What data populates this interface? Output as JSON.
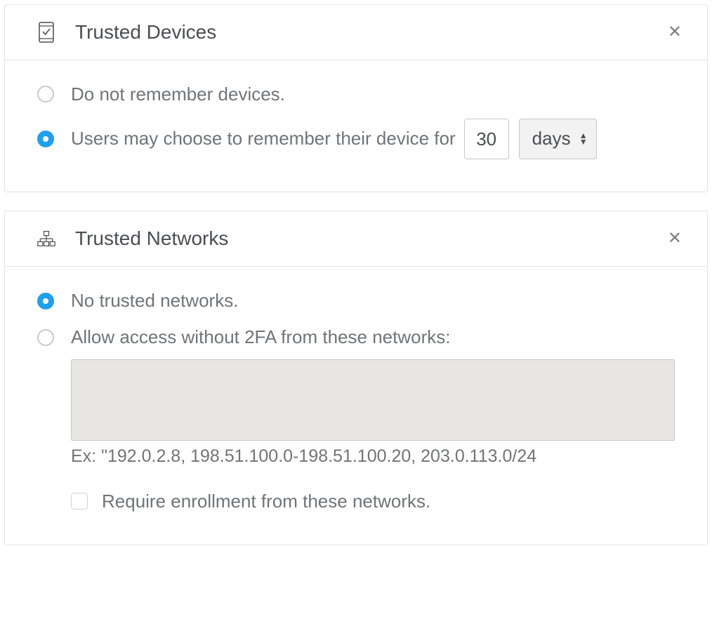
{
  "devices": {
    "title": "Trusted Devices",
    "options": {
      "no_remember": "Do not remember devices.",
      "remember_prefix": "Users may choose to remember their device for"
    },
    "duration_value": "30",
    "duration_unit": "days",
    "selected": "remember"
  },
  "networks": {
    "title": "Trusted Networks",
    "options": {
      "no_trusted": "No trusted networks.",
      "allow_label": "Allow access without 2FA from these networks:"
    },
    "textarea_value": "",
    "hint": "Ex: \"192.0.2.8, 198.51.100.0-198.51.100.20, 203.0.113.0/24",
    "require_enroll_label": "Require enrollment from these networks.",
    "selected": "no_trusted",
    "require_enroll_checked": false
  }
}
